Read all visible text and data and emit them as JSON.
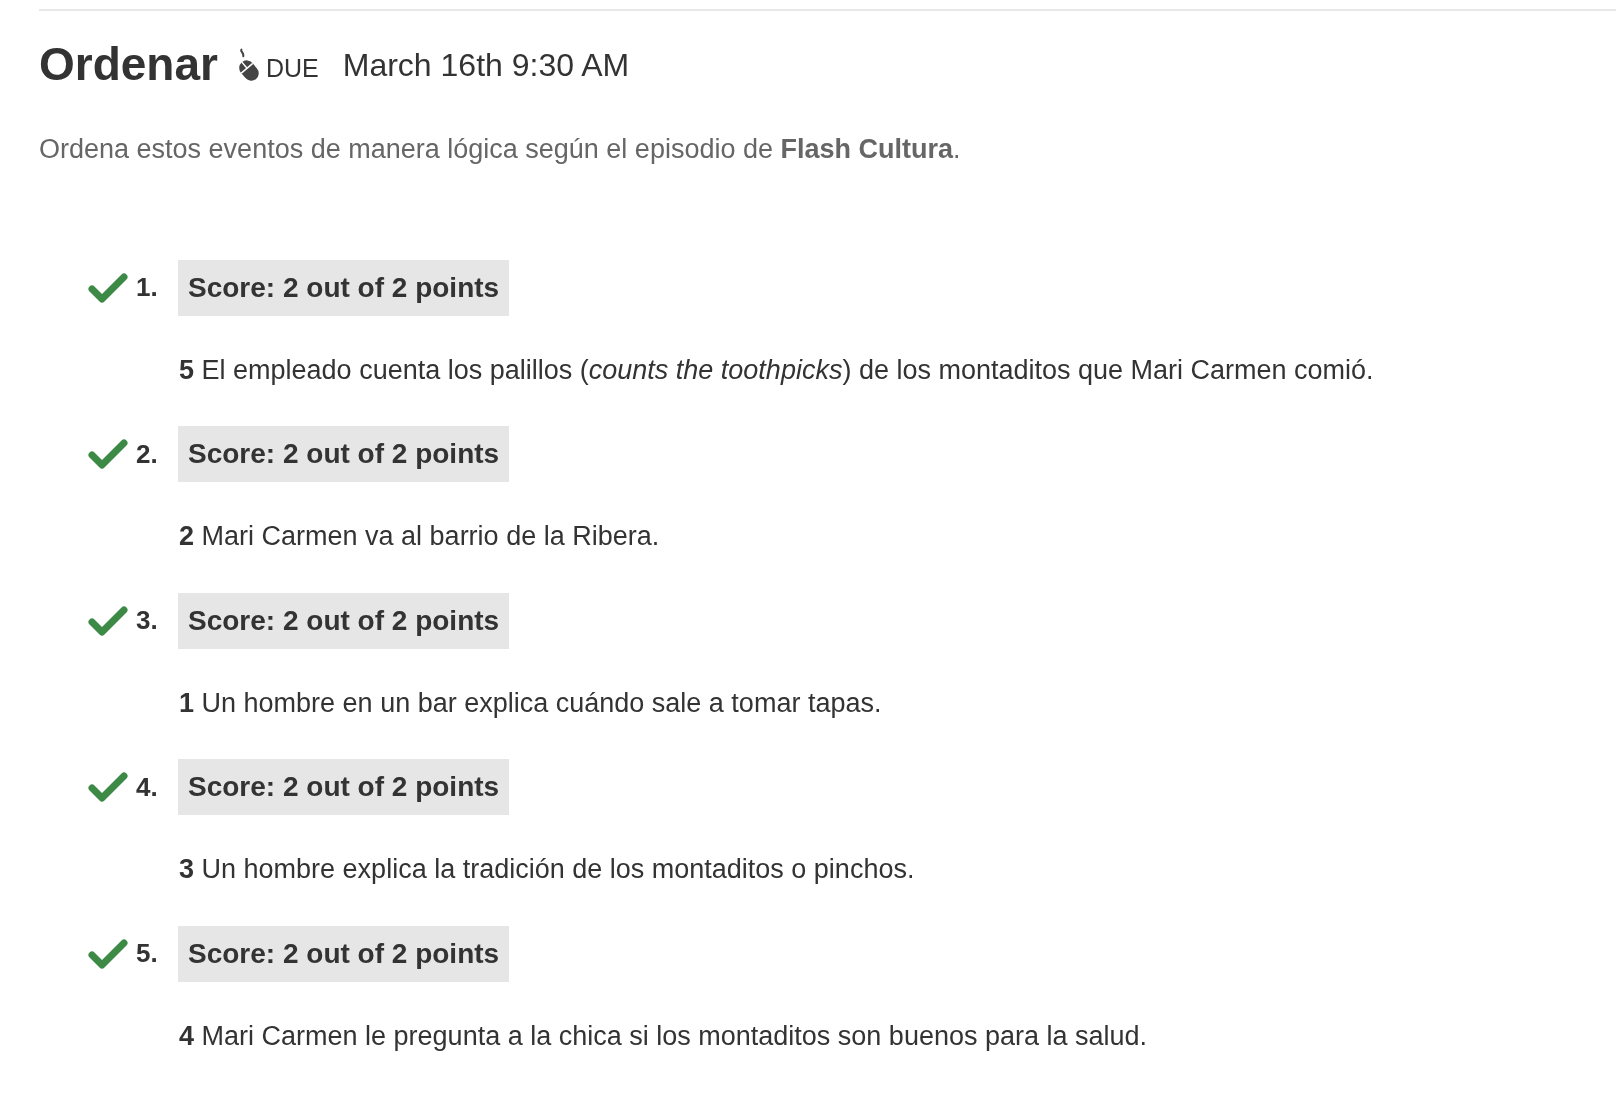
{
  "header": {
    "title": "Ordenar",
    "due_label": "DUE",
    "due_date": "March 16th 9:30 AM"
  },
  "instructions": "Ordena estos eventos de manera lógica según el episodio de **Flash Cultura**.",
  "questions": [
    {
      "number": "1.",
      "correct": true,
      "score": "Score: 2 out of 2 points",
      "answer": "**5** El empleado cuenta los palillos (*counts the toothpicks*) de los montaditos que Mari Carmen comió."
    },
    {
      "number": "2.",
      "correct": true,
      "score": "Score: 2 out of 2 points",
      "answer": "**2** Mari Carmen va al barrio de la Ribera."
    },
    {
      "number": "3.",
      "correct": true,
      "score": "Score: 2 out of 2 points",
      "answer": "**1** Un hombre en un bar explica cuándo sale a tomar tapas."
    },
    {
      "number": "4.",
      "correct": true,
      "score": "Score: 2 out of 2 points",
      "answer": "**3** Un hombre explica la tradición de los montaditos o pinchos."
    },
    {
      "number": "5.",
      "correct": true,
      "score": "Score: 2 out of 2 points",
      "answer": "**4** Mari Carmen le pregunta a la chica si los montaditos son buenos para la salud."
    }
  ]
}
